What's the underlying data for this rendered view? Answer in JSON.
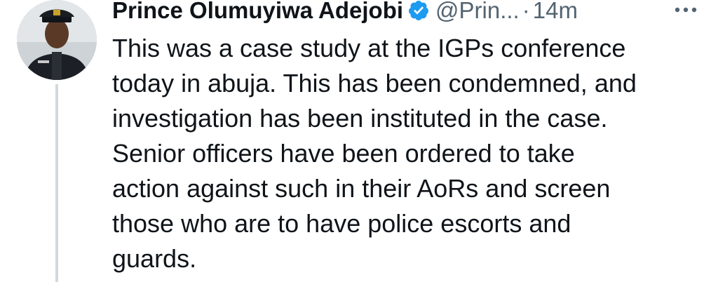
{
  "tweet": {
    "display_name": "Prince Olumuyiwa Adejobi",
    "handle": "@Prin...",
    "separator": "·",
    "time": "14m",
    "text": "This was a case study at the IGPs conference\ntoday in abuja. This has been condemned, and\ninvestigation has been instituted in the case.\nSenior officers have been ordered to take\naction against such in their AoRs and screen\nthose who are to have police escorts and\nguards.",
    "icons": {
      "verified": "verified-badge-icon",
      "more": "more-options-icon"
    },
    "colors": {
      "verified": "#1d9bf0",
      "muted": "#536471",
      "thread_line": "#cfd9de"
    }
  }
}
